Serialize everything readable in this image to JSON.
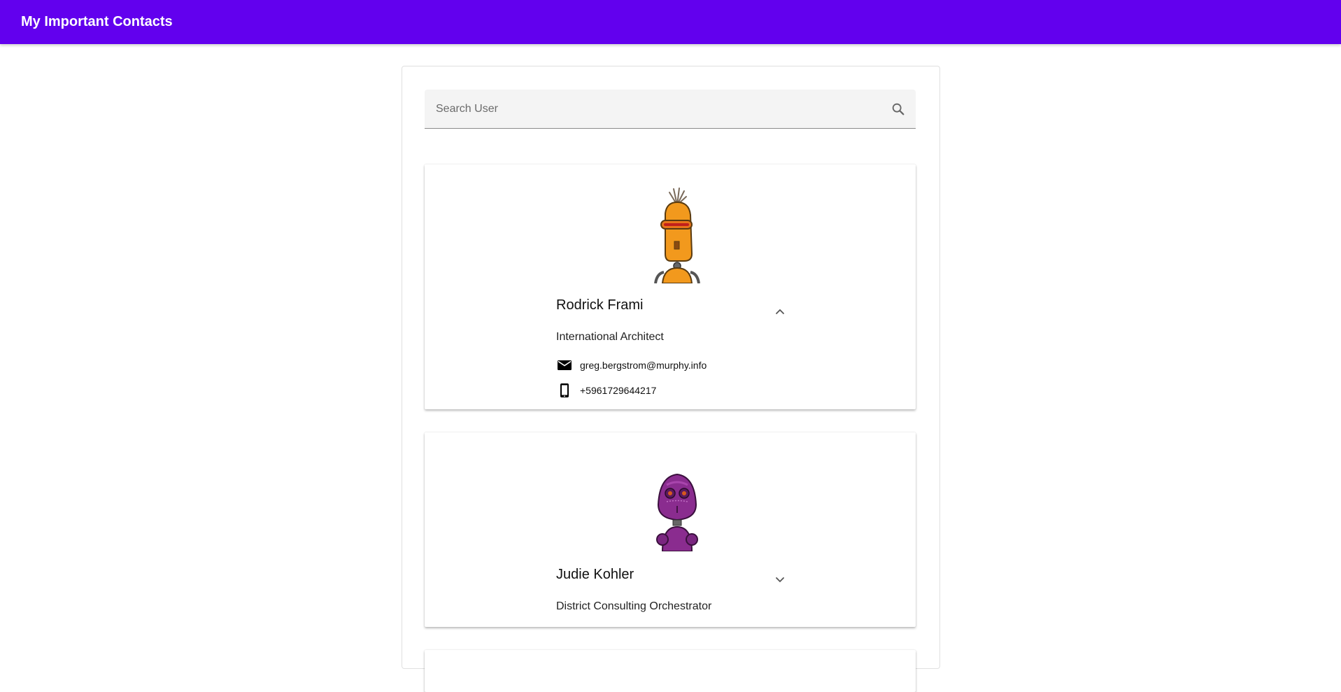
{
  "app": {
    "title": "My Important Contacts",
    "accent": "#6200ee"
  },
  "search": {
    "placeholder": "Search User",
    "value": "",
    "icon": "search-icon"
  },
  "contacts": [
    {
      "name": "Rodrick Frami",
      "job_title": "International Architect",
      "email": "greg.bergstrom@murphy.info",
      "phone": "+5961729644217",
      "expanded": true,
      "avatar": "orange-robot-avatar",
      "toggle_icon": "chevron-up-icon"
    },
    {
      "name": "Judie Kohler",
      "job_title": "District Consulting Orchestrator",
      "expanded": false,
      "avatar": "purple-robot-avatar",
      "toggle_icon": "chevron-down-icon"
    }
  ]
}
